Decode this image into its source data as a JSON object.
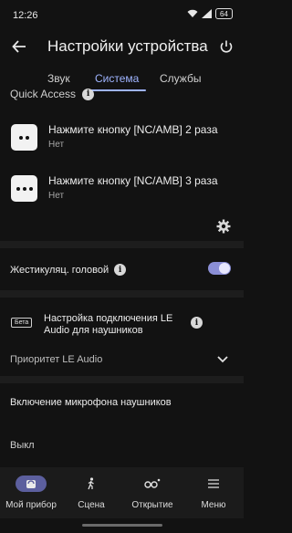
{
  "status_bar": {
    "time": "12:26",
    "battery": "64"
  },
  "header": {
    "title": "Настройки устройства"
  },
  "tabs": [
    {
      "label": "Звук",
      "active": false
    },
    {
      "label": "Система",
      "active": true
    },
    {
      "label": "Службы",
      "active": false
    }
  ],
  "quick_access": {
    "label": "Quick Access",
    "items": [
      {
        "title": "Нажмите кнопку [NC/AMB] 2 раза",
        "value": "Нет",
        "dots": 2
      },
      {
        "title": "Нажмите кнопку [NC/AMB] 3 раза",
        "value": "Нет",
        "dots": 3
      }
    ]
  },
  "head_gestures": {
    "label": "Жестикуляц. головой",
    "enabled": true
  },
  "le_audio": {
    "badge": "Бета",
    "title": "Настройка подключения LE Audio для наушников",
    "priority_label": "Приоритет LE Audio"
  },
  "mic": {
    "label": "Включение микрофона наушников",
    "value": "Выкл"
  },
  "bottom_nav": [
    {
      "label": "Мой прибор",
      "icon": "headphones-device-icon",
      "active": true
    },
    {
      "label": "Сцена",
      "icon": "walking-person-icon",
      "active": false
    },
    {
      "label": "Открытие",
      "icon": "binoculars-icon",
      "active": false
    },
    {
      "label": "Меню",
      "icon": "hamburger-menu-icon",
      "active": false
    }
  ],
  "colors": {
    "accent": "#9fb4ff",
    "toggle_on": "#8b8fd6",
    "background": "#121212"
  }
}
